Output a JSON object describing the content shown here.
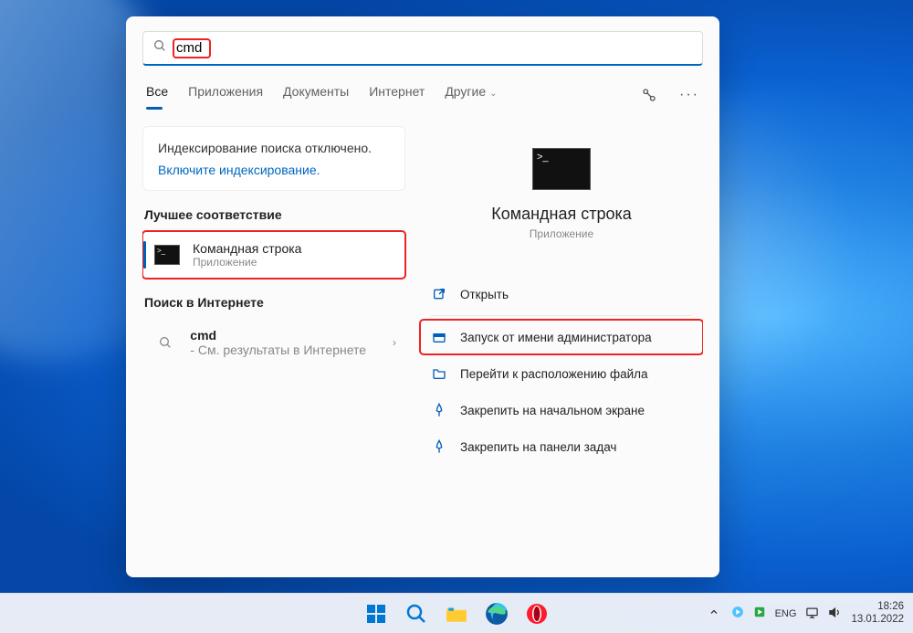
{
  "search": {
    "query": "cmd",
    "placeholder": ""
  },
  "tabs": {
    "all": "Все",
    "apps": "Приложения",
    "docs": "Документы",
    "web": "Интернет",
    "more": "Другие"
  },
  "index_notice": {
    "line": "Индексирование поиска отключено.",
    "link": "Включите индексирование."
  },
  "sections": {
    "best": "Лучшее соответствие",
    "web": "Поиск в Интернете"
  },
  "best_result": {
    "title": "Командная строка",
    "subtitle": "Приложение"
  },
  "web_result": {
    "term": "cmd",
    "desc": " - См. результаты в Интернете"
  },
  "preview": {
    "title": "Командная строка",
    "subtitle": "Приложение"
  },
  "actions": {
    "open": "Открыть",
    "admin": "Запуск от имени администратора",
    "location": "Перейти к расположению файла",
    "pin_start": "Закрепить на начальном экране",
    "pin_taskbar": "Закрепить на панели задач"
  },
  "systray": {
    "lang": "ENG",
    "time": "18:26",
    "date": "13.01.2022"
  }
}
